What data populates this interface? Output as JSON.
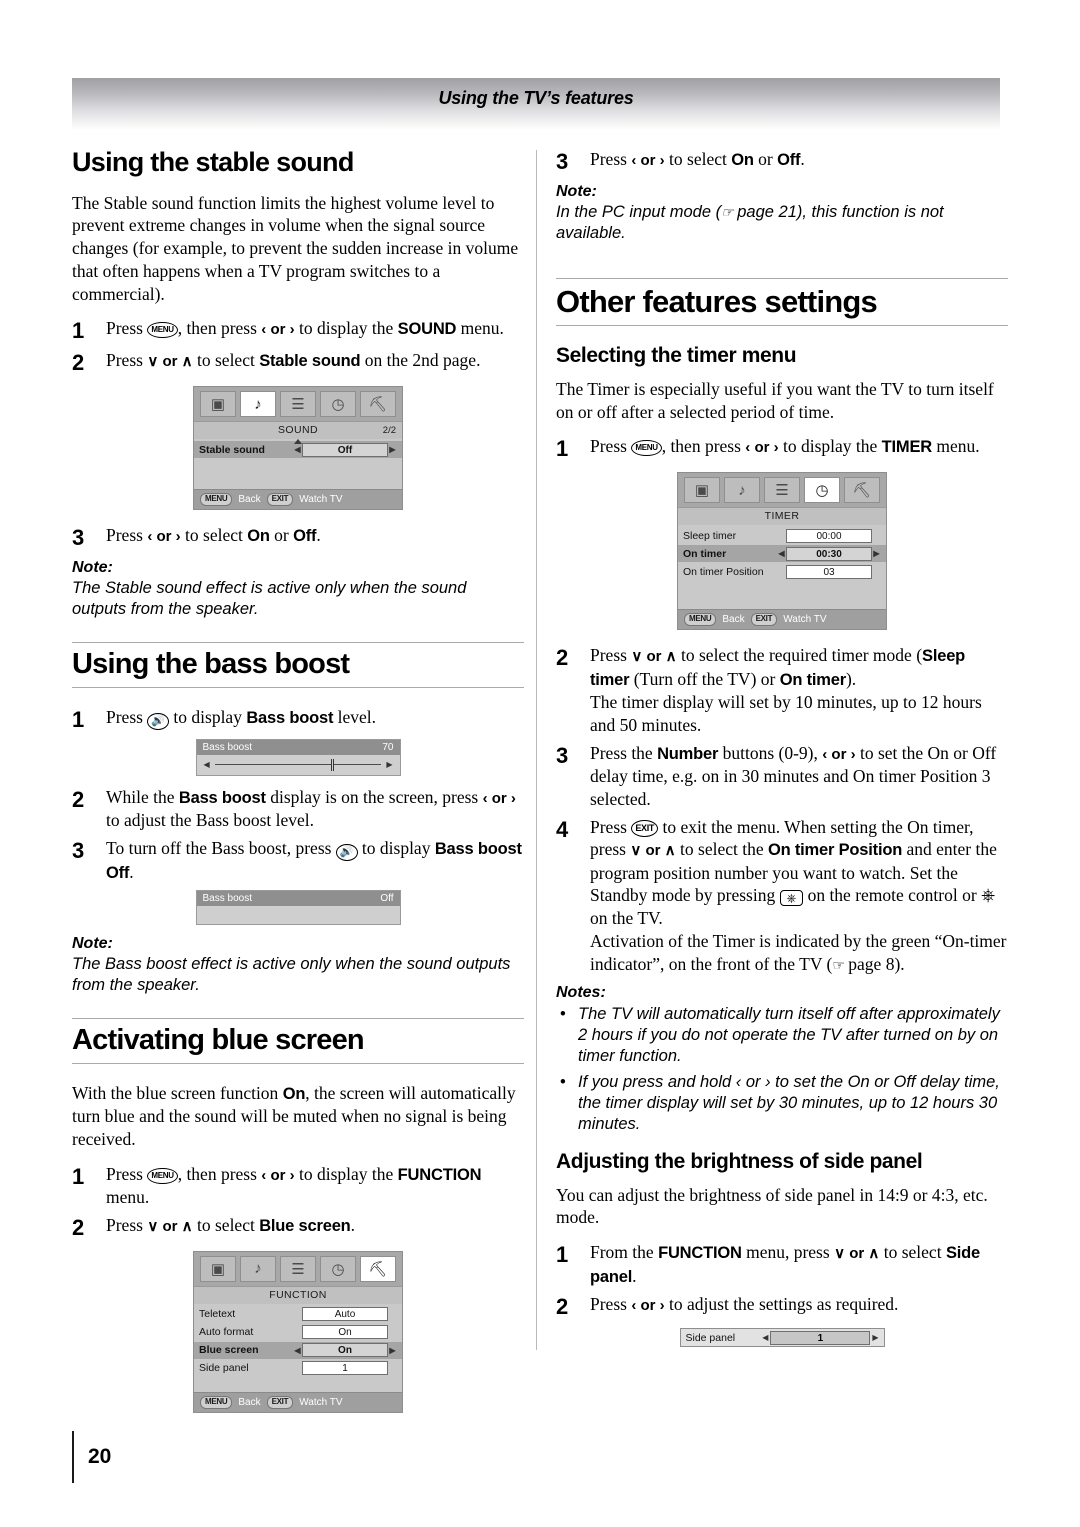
{
  "header": {
    "title": "Using the TV’s features"
  },
  "footer": {
    "page_number": "20"
  },
  "left": {
    "stable_sound": {
      "heading": "Using the stable sound",
      "intro": "The Stable sound function limits the highest volume level to prevent extreme changes in volume when the signal source changes (for example, to prevent the sudden increase in volume that often happens when a TV program switches to a commercial).",
      "steps": [
        {
          "num": "1",
          "text_pre": "Press ",
          "key": "MENU",
          "text_mid": ", then press ",
          "arrows": "‹ or ›",
          "text_post": " to display the ",
          "bold": "SOUND",
          "text_end": " menu."
        },
        {
          "num": "2",
          "text_pre": "Press ",
          "arrows": "∨ or ∧",
          "text_post": " to select ",
          "bold": "Stable sound",
          "text_end": " on the 2nd page."
        },
        {
          "num": "3",
          "text_pre": "Press ",
          "arrows": "‹ or ›",
          "text_post": " to select ",
          "bold": "On",
          "text_mid2": " or ",
          "bold2": "Off",
          "text_end": "."
        }
      ],
      "osd": {
        "title": "SOUND",
        "page": "2/2",
        "active_icon_index": 1,
        "rows": [
          {
            "label": "Stable sound",
            "value": "Off",
            "selected": true
          }
        ],
        "footer": {
          "btn1": "MENU",
          "label1": "Back",
          "btn2": "EXIT",
          "label2": "Watch TV"
        }
      },
      "note": {
        "head": "Note:",
        "text": "The Stable sound effect is active only when the sound outputs from the speaker."
      }
    },
    "bass_boost": {
      "heading": "Using the bass boost",
      "steps": [
        {
          "num": "1",
          "text_pre": "Press ",
          "key": "volume-icon",
          "text_post": " to display ",
          "bold": "Bass boost",
          "text_end": " level."
        },
        {
          "num": "2",
          "text_pre": "While the ",
          "bold": "Bass boost",
          "text_post": " display is on the screen, press ",
          "arrows": "‹ or ›",
          "text_end": " to adjust the Bass boost level."
        },
        {
          "num": "3",
          "text_pre": "To turn off the Bass boost, press ",
          "key": "volume-icon",
          "text_post": " to display ",
          "bold": "Bass boost Off",
          "text_end": "."
        }
      ],
      "bar_level": {
        "label": "Bass boost",
        "value": "70",
        "knob_percent": 70
      },
      "bar_off": {
        "label": "Bass boost",
        "value": "Off"
      },
      "note": {
        "head": "Note:",
        "text": "The Bass boost effect is active only when the sound outputs from the speaker."
      }
    },
    "blue_screen": {
      "heading": "Activating blue screen",
      "intro_pre": "With the blue screen function ",
      "intro_bold": "On",
      "intro_post": ", the screen will automatically turn blue and the sound will be muted when no signal is being received.",
      "steps": [
        {
          "num": "1",
          "text_pre": "Press ",
          "key": "MENU",
          "text_mid": ", then press ",
          "arrows": "‹ or ›",
          "text_post": " to display the ",
          "bold": "FUNCTION",
          "text_end": " menu."
        },
        {
          "num": "2",
          "text_pre": "Press ",
          "arrows": "∨ or ∧",
          "text_post": " to select ",
          "bold": "Blue screen",
          "text_end": "."
        }
      ],
      "osd": {
        "title": "FUNCTION",
        "page": "",
        "active_icon_index": 4,
        "rows": [
          {
            "label": "Teletext",
            "value": "Auto",
            "selected": false
          },
          {
            "label": "Auto format",
            "value": "On",
            "selected": false
          },
          {
            "label": "Blue screen",
            "value": "On",
            "selected": true
          },
          {
            "label": "Side panel",
            "value": "1",
            "selected": false
          }
        ],
        "footer": {
          "btn1": "MENU",
          "label1": "Back",
          "btn2": "EXIT",
          "label2": "Watch TV"
        }
      }
    }
  },
  "right": {
    "top_step": {
      "num": "3",
      "text_pre": "Press ",
      "arrows": "‹ or ›",
      "text_post": " to select ",
      "bold": "On",
      "text_mid2": " or ",
      "bold2": "Off",
      "text_end": "."
    },
    "top_note": {
      "head": "Note:",
      "text_pre": "In the PC input mode (",
      "text_ref": " page 21),",
      "text_post": " this function is not available."
    },
    "other_features": {
      "heading": "Other features settings"
    },
    "timer_menu": {
      "heading": "Selecting the timer menu",
      "intro": "The Timer is especially useful if you want the TV to turn itself on or off after a selected period of time.",
      "step1": {
        "num": "1",
        "text_pre": "Press ",
        "key": "MENU",
        "text_mid": ", then press ",
        "arrows": "‹ or ›",
        "text_post": " to display the ",
        "bold": "TIMER",
        "text_end": " menu."
      },
      "osd": {
        "title": "TIMER",
        "page": "",
        "active_icon_index": 3,
        "rows": [
          {
            "label": "Sleep timer",
            "value": "00:00",
            "selected": false
          },
          {
            "label": "On timer",
            "value": "00:30",
            "selected": true
          },
          {
            "label": "On timer Position",
            "value": "03",
            "selected": false
          }
        ],
        "footer": {
          "btn1": "MENU",
          "label1": "Back",
          "btn2": "EXIT",
          "label2": "Watch TV"
        }
      },
      "step2": {
        "num": "2",
        "text_pre": "Press ",
        "arrows": "∨ or ∧",
        "text_post": " to select the required timer mode (",
        "bold": "Sleep timer",
        "text_mid": " (Turn off the TV) or ",
        "bold2": "On timer",
        "text_end": ").",
        "text_line2": "The timer display will set by 10 minutes, up to 12 hours and 50 minutes."
      },
      "step3": {
        "num": "3",
        "text_pre": "Press the ",
        "bold": "Number",
        "text_post": " buttons (0-9), ",
        "arrows": "‹ or ›",
        "text_end": " to set the On or Off delay time,  e.g. on in 30 minutes and On timer Position 3 selected."
      },
      "step4": {
        "num": "4",
        "text_pre": "Press ",
        "key": "EXIT",
        "text_post": " to exit the menu. When setting the On timer, press ",
        "arrows": "∨ or ∧",
        "text_mid": " to select the ",
        "bold": "On timer Position",
        "text_end": " and enter the program position number you want to watch. Set the Standby mode by pressing ",
        "text_end2": " on the remote control or ",
        "text_end3": " on the TV.",
        "text_line2_pre": "Activation of the Timer is indicated by the green “On-timer indicator”, on the front of the TV (",
        "text_line2_ref": " page 8)."
      },
      "notes": {
        "head": "Notes:",
        "items": [
          "The TV will automatically turn itself off after approximately 2 hours if you do not operate the TV after turned on by on timer function.",
          "If you press and hold ‹ or › to set the On or Off delay time, the timer display will set by 30 minutes, up to 12 hours 30 minutes."
        ]
      }
    },
    "side_panel": {
      "heading": "Adjusting the brightness of side panel",
      "intro": "You can adjust the brightness of side panel in 14:9 or 4:3, etc. mode.",
      "step1": {
        "num": "1",
        "text_pre": "From the ",
        "bold": "FUNCTION",
        "text_post": " menu, press ",
        "arrows": "∨ or ∧",
        "text_mid": " to select ",
        "bold2": "Side panel",
        "text_end": "."
      },
      "step2": {
        "num": "2",
        "text_pre": "Press ",
        "arrows": "‹ or ›",
        "text_end": " to adjust the settings as required."
      },
      "bar": {
        "label": "Side panel",
        "value": "1"
      }
    }
  },
  "icons": {
    "osd_tabs": [
      "picture-icon",
      "sound-icon",
      "lines-icon",
      "clock-icon",
      "wrench-icon"
    ],
    "glyphs": [
      "❑",
      "♪",
      "☰",
      "◴",
      "⛏"
    ]
  }
}
